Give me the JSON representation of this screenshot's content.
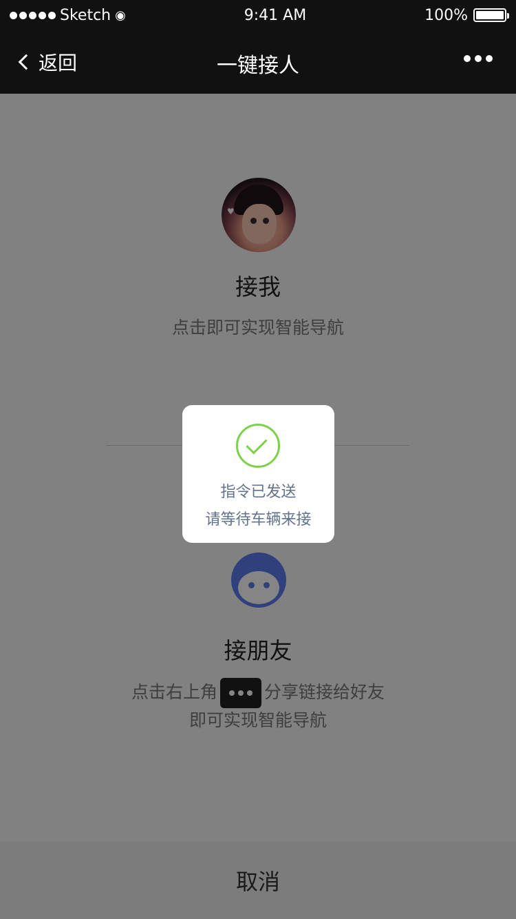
{
  "status_bar": {
    "carrier": "Sketch",
    "time": "9:41 AM",
    "battery": "100%",
    "battery_level": 1.0
  },
  "nav": {
    "back_label": "返回",
    "title": "一键接人"
  },
  "pickup_me": {
    "title": "接我",
    "desc": "点击即可实现智能导航"
  },
  "pickup_friend": {
    "title": "接朋友",
    "desc_before": "点击右上角",
    "desc_after": "分享链接给好友",
    "desc_line2": "即可实现智能导航"
  },
  "toast": {
    "line1": "指令已发送",
    "line2": "请等待车辆来接"
  },
  "cancel_label": "取消",
  "colors": {
    "nav_bg": "#111111",
    "accent_green": "#7ed04b",
    "friend_blue": "#5c7cf0"
  }
}
